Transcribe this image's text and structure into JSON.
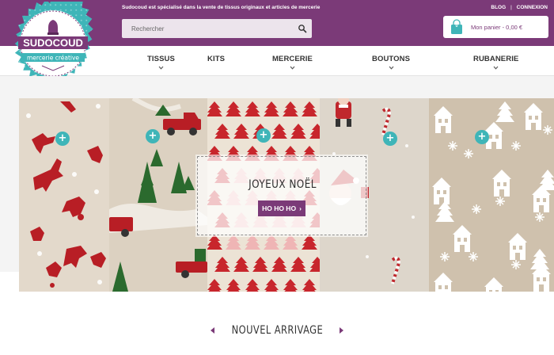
{
  "header": {
    "tagline": "Sudocoud est spécialisé dans la vente de tissus originaux et articles de mercerie",
    "search_placeholder": "Rechercher",
    "links": {
      "blog": "BLOG",
      "separator": "|",
      "login": "CONNEXION"
    },
    "cart": {
      "count": "0",
      "label": "Mon panier - 0,00 €"
    }
  },
  "logo": {
    "name": "SUDOCOUD",
    "subtitle": "mercerie créative"
  },
  "nav": {
    "items": [
      {
        "label": "TISSUS",
        "has_dropdown": true
      },
      {
        "label": "KITS",
        "has_dropdown": false
      },
      {
        "label": "MERCERIE",
        "has_dropdown": true
      },
      {
        "label": "BOUTONS",
        "has_dropdown": true
      },
      {
        "label": "RUBANERIE",
        "has_dropdown": true
      }
    ]
  },
  "hero": {
    "title": "JOYEUX NOËL",
    "button_label": "HO HO HO",
    "button_arrow": "›",
    "plus_label": "+"
  },
  "section": {
    "title": "NOUVEL ARRIVAGE"
  },
  "colors": {
    "brand": "#7b3a78",
    "accent": "#3fb5b8",
    "red": "#c0272d"
  }
}
